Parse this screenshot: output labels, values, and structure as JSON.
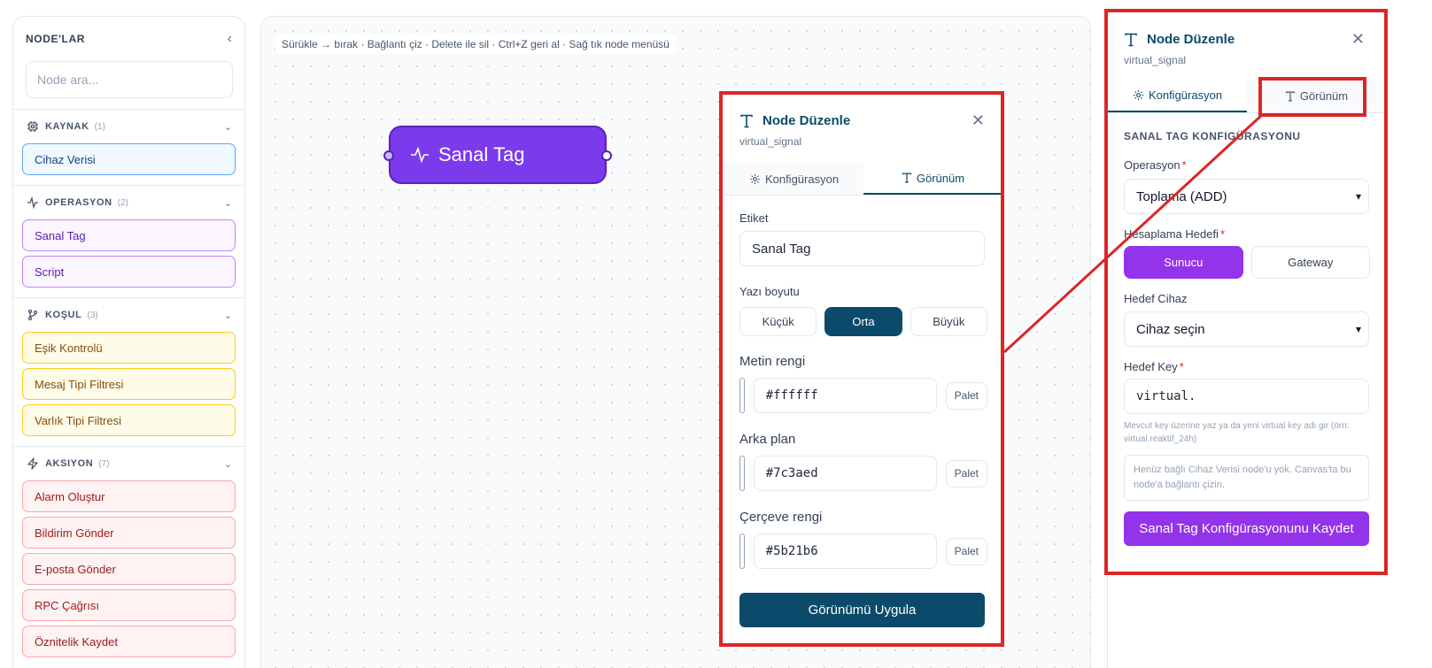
{
  "sidebar": {
    "title": "NODE'LAR",
    "search_placeholder": "Node ara...",
    "sections": [
      {
        "icon": "chip-icon",
        "title": "KAYNAK",
        "count": "(1)",
        "items": [
          "Cihaz Verisi"
        ],
        "color": "blue"
      },
      {
        "icon": "activity-icon",
        "title": "OPERASYON",
        "count": "(2)",
        "items": [
          "Sanal Tag",
          "Script"
        ],
        "color": "purple"
      },
      {
        "icon": "git-branch-icon",
        "title": "KOŞUL",
        "count": "(3)",
        "items": [
          "Eşik Kontrolü",
          "Mesaj Tipi Filtresi",
          "Varlık Tipi Filtresi"
        ],
        "color": "yellow"
      },
      {
        "icon": "zap-icon",
        "title": "AKSIYON",
        "count": "(7)",
        "items": [
          "Alarm Oluştur",
          "Bildirim Gönder",
          "E-posta Gönder",
          "RPC Çağrısı",
          "Öznitelik Kaydet"
        ],
        "color": "red"
      }
    ]
  },
  "canvas": {
    "hint": "Sürükle → bırak · Bağlantı çiz · Delete ile sil · Ctrl+Z geri al · Sağ tık node menüsü",
    "node_label": "Sanal Tag"
  },
  "appearance_panel": {
    "title": "Node Düzenle",
    "subtitle": "virtual_signal",
    "tab_config": "Konfigürasyon",
    "tab_view": "Görünüm",
    "label_field": "Etiket",
    "label_value": "Sanal Tag",
    "font_size_label": "Yazı boyutu",
    "font_sizes": [
      "Küçük",
      "Orta",
      "Büyük"
    ],
    "text_color_label": "Metin rengi",
    "text_color": "#ffffff",
    "bg_label": "Arka plan",
    "bg_color": "#7c3aed",
    "border_label": "Çerçeve rengi",
    "border_color": "#5b21b6",
    "palette": "Palet",
    "apply": "Görünümü Uygula"
  },
  "config_panel": {
    "title": "Node Düzenle",
    "subtitle": "virtual_signal",
    "tab_config": "Konfigürasyon",
    "tab_view": "Görünüm",
    "section_title": "SANAL TAG KONFIGÜRASYONU",
    "operation_label": "Operasyon",
    "operation_value": "Toplama (ADD)",
    "target_label": "Hesaplama Hedefi",
    "target_server": "Sunucu",
    "target_gateway": "Gateway",
    "device_label": "Hedef Cihaz",
    "device_value": "Cihaz seçin",
    "key_label": "Hedef Key",
    "key_value": "virtual.",
    "key_help": "Mevcut key üzerine yaz ya da yeni virtual key adı gir (örn: virtual.reaktif_24h)",
    "note": "Henüz bağlı Cihaz Verisi node'u yok. Canvas'ta bu node'a bağlantı çizin.",
    "save": "Sanal Tag Konfigürasyonunu Kaydet"
  },
  "colors": {
    "accent_dark": "#0b4a6a",
    "accent_purple": "#9333ea",
    "node_fill": "#7c3aed",
    "node_border": "#5b21b6",
    "highlight": "#dc2626"
  }
}
